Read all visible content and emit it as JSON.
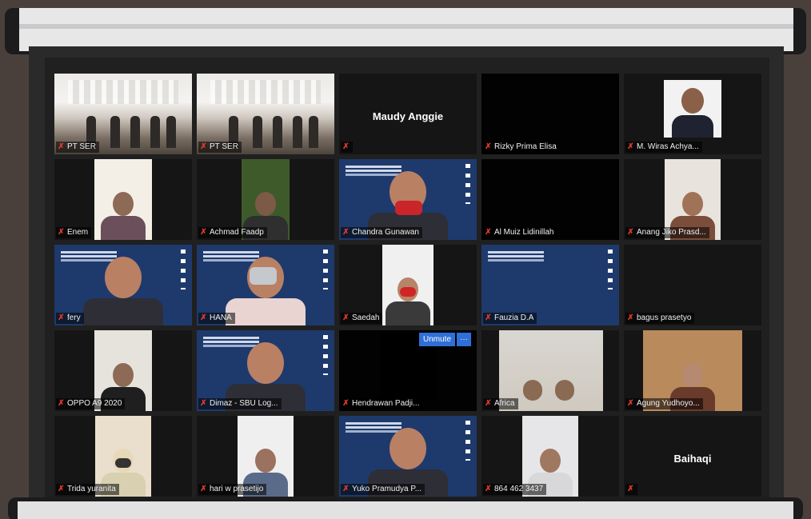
{
  "meeting": {
    "participants": [
      {
        "name": "PT SER",
        "video": "hall",
        "active": false
      },
      {
        "name": "PT SER",
        "video": "hall",
        "active": true
      },
      {
        "name": "",
        "center_name": "Maudy Anggie",
        "video": "none"
      },
      {
        "name": "Rizky Prima Elisa",
        "video": "black"
      },
      {
        "name": "M. Wiras Achya...",
        "video": "photo"
      },
      {
        "name": "Enem",
        "video": "person"
      },
      {
        "name": "Achmad Faadp",
        "video": "person"
      },
      {
        "name": "Chandra Gunawan",
        "video": "slide"
      },
      {
        "name": "Al Muiz Lidinillah",
        "video": "black"
      },
      {
        "name": "Anang Jiko Prasd...",
        "video": "person"
      },
      {
        "name": "fery",
        "video": "slide"
      },
      {
        "name": "HANA",
        "video": "slide"
      },
      {
        "name": "Saedah",
        "video": "person"
      },
      {
        "name": "Fauzia D.A",
        "video": "slide"
      },
      {
        "name": "bagus prasetyo",
        "video": "none"
      },
      {
        "name": "OPPO A9 2020",
        "video": "person"
      },
      {
        "name": "Dimaz - SBU Log...",
        "video": "slide"
      },
      {
        "name": "Hendrawan Padji...",
        "video": "black"
      },
      {
        "name": "Africa",
        "video": "room"
      },
      {
        "name": "Agung Yudhoyo...",
        "video": "person"
      },
      {
        "name": "Trida yuranita",
        "video": "person"
      },
      {
        "name": "hari w prasetijo",
        "video": "person"
      },
      {
        "name": "Yuko Pramudya P...",
        "video": "slide"
      },
      {
        "name": "864 462 3437",
        "video": "person"
      },
      {
        "name": "",
        "center_name": "Baihaqi",
        "video": "none"
      }
    ],
    "unmute_button": {
      "label": "Unmute",
      "more_label": "···"
    },
    "mic_icon_glyph": "ﾇ",
    "colors": {
      "mic_muted": "#e33a2b",
      "active_speaker": "#c8d23a",
      "button": "#2f6fd8"
    }
  }
}
